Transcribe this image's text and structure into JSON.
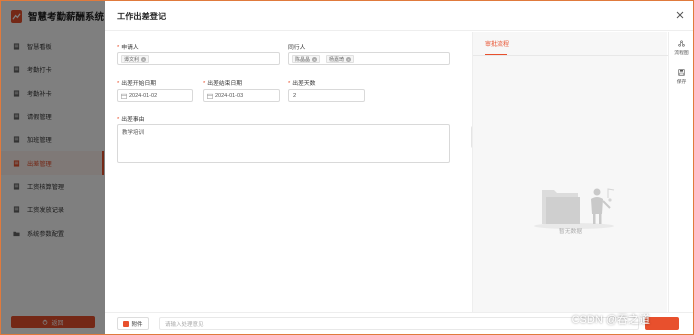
{
  "app": {
    "title": "智慧考勤薪酬系统",
    "exit_label": "返回"
  },
  "sidebar": {
    "items": [
      {
        "label": "智慧看板",
        "icon": "document-icon"
      },
      {
        "label": "考勤打卡",
        "icon": "document-icon"
      },
      {
        "label": "考勤补卡",
        "icon": "document-icon"
      },
      {
        "label": "请假管理",
        "icon": "document-icon"
      },
      {
        "label": "加班管理",
        "icon": "document-icon"
      },
      {
        "label": "出差管理",
        "icon": "document-icon",
        "active": true
      },
      {
        "label": "工资核算管理",
        "icon": "document-icon"
      },
      {
        "label": "工资发放记录",
        "icon": "document-icon"
      },
      {
        "label": "系统参数配置",
        "icon": "folder-icon"
      }
    ]
  },
  "drawer": {
    "title": "工作出差登记",
    "form": {
      "applicant_label": "申请人",
      "applicant_tags": [
        "谭文利"
      ],
      "companions_label": "同行人",
      "companion_tags": [
        "陈晶晶",
        "杨嘉琦"
      ],
      "start_label": "出差开始日期",
      "start_value": "2024-01-02",
      "end_label": "出差结束日期",
      "end_value": "2024-01-03",
      "days_label": "出差天数",
      "days_value": "2",
      "reason_label": "出差事由",
      "reason_value": "教学培训"
    },
    "flow": {
      "tab_label": "审批流程",
      "empty_text": "暂无数据"
    },
    "rail": {
      "flowchart_label": "流程图",
      "save_label": "保存"
    },
    "footer": {
      "attach_label": "附件",
      "comment_placeholder": "请输入处理意见"
    }
  },
  "watermark": "CSDN @吞之道",
  "colors": {
    "accent": "#e8502d",
    "overlay": "rgba(0,0,0,0.5)"
  }
}
